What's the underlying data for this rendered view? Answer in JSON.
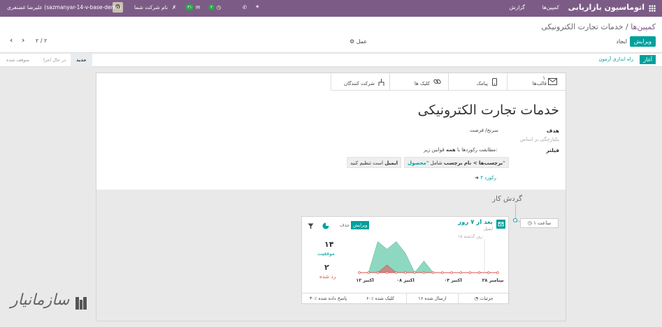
{
  "topbar": {
    "app_name": "اتوماسیون بازاریابی",
    "menu": [
      "کمپین‌ها",
      "گزارش"
    ],
    "messages_count": "۲",
    "activities_count": "۳۱",
    "company": "نام شرکت شما",
    "user": "علیرضا غضنفری (sazmanyar-14-v-base-demo)"
  },
  "breadcrumb": {
    "parent": "کمپین‌ها",
    "separator": "/",
    "current": "خدمات تجارت الکترونیکی"
  },
  "toolbar": {
    "edit": "ویرایش",
    "create": "ایجاد",
    "action": "عمل",
    "pager": "۲ / ۲"
  },
  "statusbar": {
    "start": "آغاز",
    "test": "راه اندازی آزمون",
    "stages": [
      "جدید",
      "در حال اجرا",
      "متوقف شده"
    ]
  },
  "smart_buttons": [
    {
      "label": "قالب‌ها",
      "count": "۱",
      "icon": "envelope-icon"
    },
    {
      "label": "پیامک",
      "count": "",
      "icon": "mobile-icon"
    },
    {
      "label": "کلیک ها",
      "count": "",
      "icon": "link-icon"
    },
    {
      "label": "شرکت کنندگان",
      "count": "",
      "icon": "sitemap-icon"
    }
  ],
  "form": {
    "title": "خدمات تجارت الکترونیکی",
    "goal_label": "هدف",
    "goal_value": "سرنخ/ فرصت",
    "unique_label": "یکپارچگی بر اساس",
    "filter_label": "فیلتر",
    "filter_rule": {
      "prefix": "مطابقت رکوردها با",
      "bold": "همه",
      "suffix": "قوانین زیر:"
    },
    "chip1": {
      "field": "برچسب‌ها > نام برچسب",
      "op": "شامل",
      "value": "\"محصول\""
    },
    "chip2": {
      "field": "ایمیل",
      "op": "است تنظیم کنید"
    },
    "records": "۳ رکورد"
  },
  "workflow": {
    "title": "گردش کار",
    "trigger": "۱ ساعت",
    "activity": {
      "title": "بعد از ۷ روز",
      "subtitle": "ایمیل",
      "edit": "ویرایش",
      "delete": "حذف",
      "graph_label": "۱۵ روز گذشته",
      "success_count": "۱۴",
      "success_label": "موفقیت",
      "rejected_count": "۲",
      "rejected_label": "رد شده",
      "footer": [
        "جزئیات",
        "۱۶ ارسال شده",
        "۶۰٪ کلیک شده",
        "۳۰٪ پاسخ داده شده"
      ]
    }
  },
  "chart_data": {
    "type": "area",
    "title": "",
    "x_ticks": [
      "۲۸ سپتامبر",
      "۰۳ اکتبر",
      "۰۸ اکتبر",
      "۱۲ اکتبر"
    ],
    "series": [
      {
        "values": [
          0,
          0,
          0,
          0,
          0,
          0,
          0,
          0,
          3,
          0,
          5,
          8,
          6,
          8,
          0,
          0
        ]
      },
      {
        "values": [
          0,
          0,
          0,
          0,
          0,
          0,
          0,
          0,
          0,
          0,
          0,
          0,
          2,
          0,
          0,
          0
        ]
      }
    ],
    "colors": [
      "#7ad1b6",
      "#c8877f"
    ],
    "ylim": [
      0,
      9
    ],
    "grid": false
  },
  "watermark": "سازمانیار"
}
